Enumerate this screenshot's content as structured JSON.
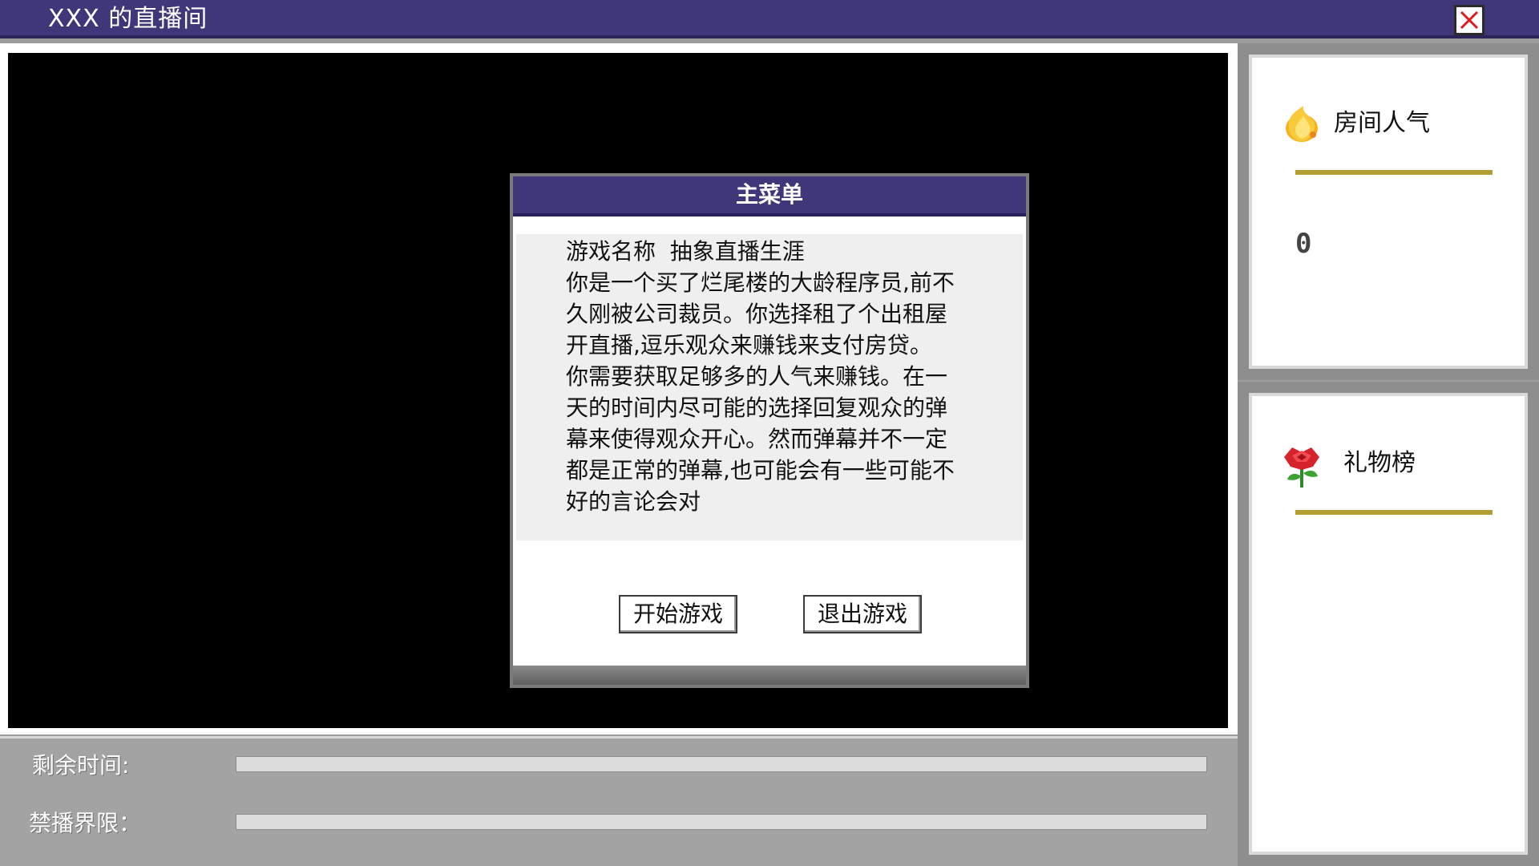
{
  "window": {
    "title": "XXX 的直播间",
    "close_icon": "close-icon",
    "accent_color": "#3f3779"
  },
  "dialog": {
    "title": "主菜单",
    "body": "游戏名称  抽象直播生涯\n你是一个买了烂尾楼的大龄程序员,前不久刚被公司裁员。你选择租了个出租屋开直播,逗乐观众来赚钱来支付房贷。\n你需要获取足够多的人气来赚钱。在一天的时间内尽可能的选择回复观众的弹幕来使得观众开心。然而弹幕并不一定都是正常的弹幕,也可能会有一些可能不好的言论会对",
    "start_button": "开始游戏",
    "quit_button": "退出游戏"
  },
  "status": {
    "time_label": "剩余时间:",
    "ban_label": "禁播界限：",
    "time_progress": 0,
    "ban_progress": 0
  },
  "sidebar": {
    "popularity": {
      "label": "房间人气",
      "icon": "fire-icon",
      "value": "0"
    },
    "gifts": {
      "label": "礼物榜",
      "icon": "rose-icon"
    },
    "line_color": "#b3a035"
  }
}
